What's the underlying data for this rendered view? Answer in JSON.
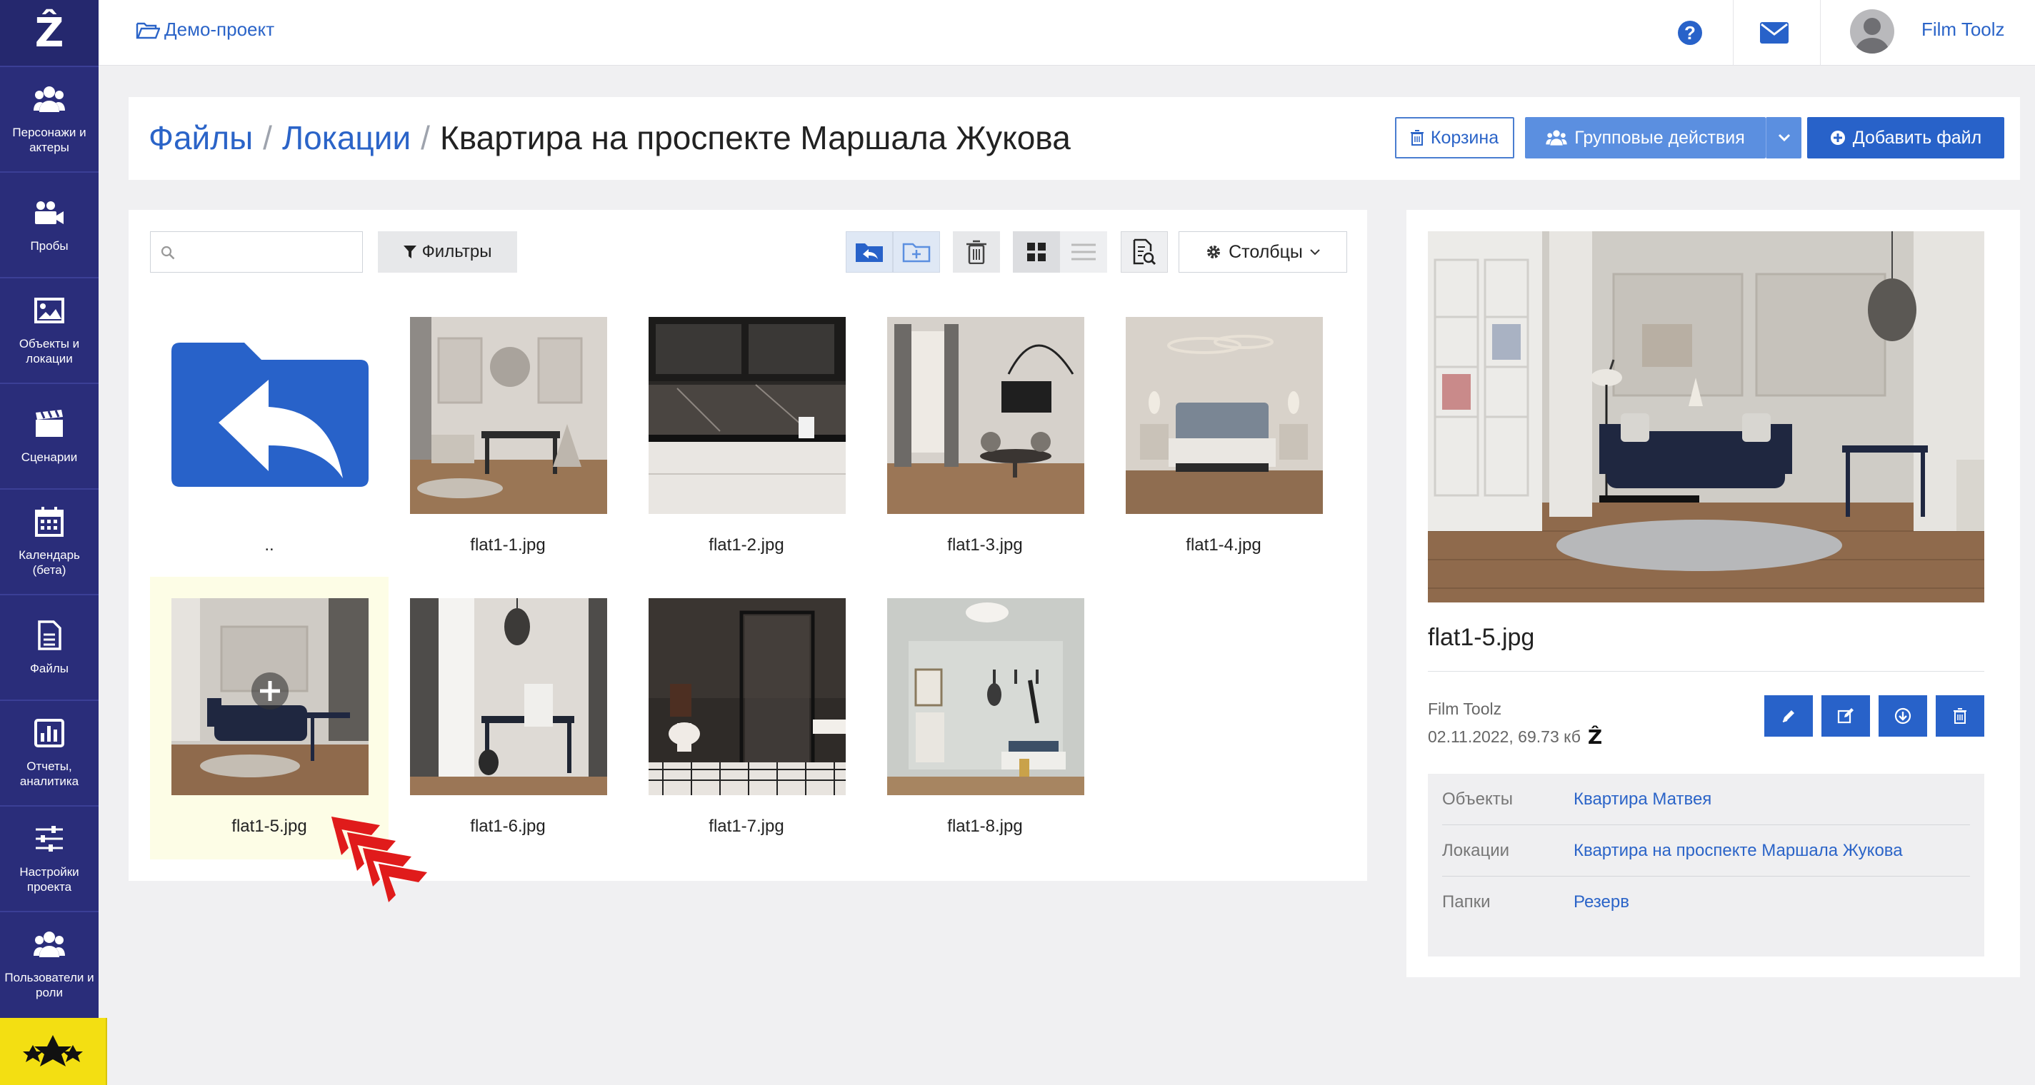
{
  "app": {
    "logo_text": "Ẑ"
  },
  "sidebar": {
    "items": [
      {
        "label": "Персонажи и актеры",
        "icon": "users-icon"
      },
      {
        "label": "Пробы",
        "icon": "video-camera-icon"
      },
      {
        "label": "Объекты и локации",
        "icon": "image-icon"
      },
      {
        "label": "Сценарии",
        "icon": "clapperboard-icon"
      },
      {
        "label": "Календарь (бета)",
        "icon": "calendar-icon"
      },
      {
        "label": "Файлы",
        "icon": "file-icon"
      },
      {
        "label": "Отчеты, аналитика",
        "icon": "bar-chart-icon"
      },
      {
        "label": "Настройки проекта",
        "icon": "sliders-icon"
      },
      {
        "label": "Пользователи и роли",
        "icon": "users-icon"
      }
    ]
  },
  "topbar": {
    "project": "Демо-проект",
    "user_name": "Film Toolz"
  },
  "header": {
    "breadcrumb": [
      "Файлы",
      "Локации",
      "Квартира на проспекте Маршала Жукова"
    ],
    "separator": "/",
    "trash_label": "Корзина",
    "group_actions_label": "Групповые действия",
    "add_file_label": "Добавить файл"
  },
  "toolbar": {
    "search_placeholder": "",
    "filters_label": "Фильтры",
    "columns_label": "Столбцы"
  },
  "files": [
    {
      "name": ".."
    },
    {
      "name": "flat1-1.jpg"
    },
    {
      "name": "flat1-2.jpg"
    },
    {
      "name": "flat1-3.jpg"
    },
    {
      "name": "flat1-4.jpg"
    },
    {
      "name": "flat1-5.jpg",
      "selected": true
    },
    {
      "name": "flat1-6.jpg"
    },
    {
      "name": "flat1-7.jpg"
    },
    {
      "name": "flat1-8.jpg"
    }
  ],
  "preview": {
    "name": "flat1-5.jpg",
    "owner": "Film Toolz",
    "meta": "02.11.2022, 69.73 кб",
    "info": [
      {
        "key": "Объекты",
        "value": "Квартира Матвея"
      },
      {
        "key": "Локации",
        "value": "Квартира на проспекте Маршала Жукова"
      },
      {
        "key": "Папки",
        "value": "Резерв"
      }
    ]
  },
  "colors": {
    "sidebar": "#2a2d7a",
    "accent": "#2862c9",
    "link": "#2b64c8",
    "highlight": "#fdfde6",
    "arrow": "#e01b1b",
    "star_box": "#f3df12"
  }
}
